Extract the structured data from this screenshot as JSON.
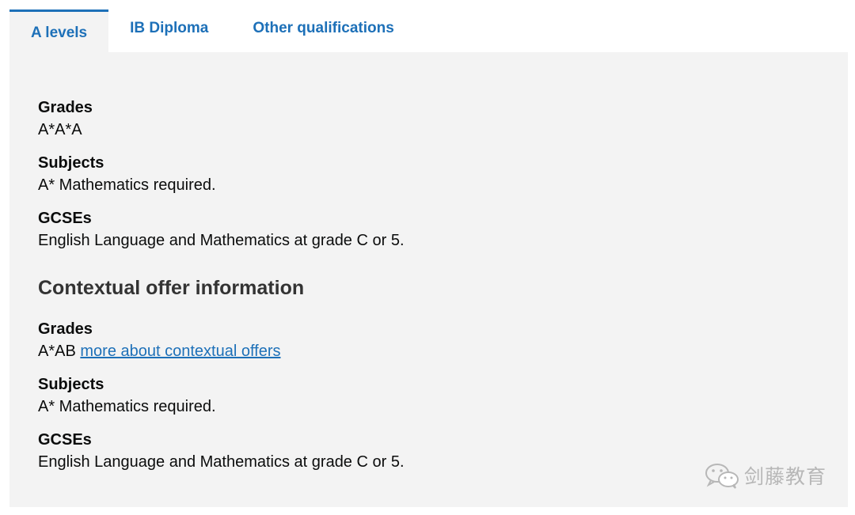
{
  "tabs": [
    {
      "label": "A levels",
      "active": true
    },
    {
      "label": "IB Diploma",
      "active": false
    },
    {
      "label": "Other qualifications",
      "active": false
    }
  ],
  "requirements": {
    "grades_label": "Grades",
    "grades_value": "A*A*A",
    "subjects_label": "Subjects",
    "subjects_value": "A* Mathematics required.",
    "gcses_label": "GCSEs",
    "gcses_value": "English Language and Mathematics at grade C or 5."
  },
  "contextual": {
    "heading": "Contextual offer information",
    "grades_label": "Grades",
    "grades_value": "A*AB",
    "grades_link": "more about contextual offers",
    "subjects_label": "Subjects",
    "subjects_value": "A* Mathematics required.",
    "gcses_label": "GCSEs",
    "gcses_value": "English Language and Mathematics at grade C or 5."
  },
  "watermark": {
    "text": "剑藤教育",
    "icon": "wechat-icon"
  },
  "colors": {
    "link": "#1d70b8",
    "panel_background": "#f3f3f3",
    "text": "#0b0c0c"
  }
}
